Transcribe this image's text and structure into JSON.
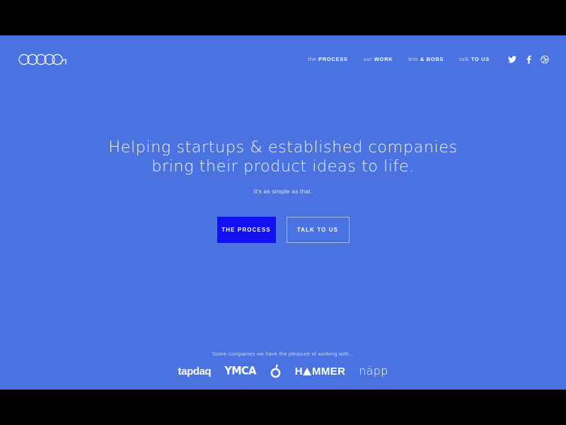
{
  "brand": {
    "logo_text": "cocoon",
    "background_color": "#4a72e0",
    "accent_color": "#1111f4",
    "letterbox_color": "#000000"
  },
  "header": {
    "nav": [
      {
        "light": "the ",
        "strong": "PROCESS",
        "name": "process"
      },
      {
        "light": "our ",
        "strong": "WORK",
        "name": "work"
      },
      {
        "light": "bits ",
        "strong": "& BOBS",
        "name": "bits-and-bobs"
      },
      {
        "light": "talk ",
        "strong": "TO US",
        "name": "talk-to-us"
      }
    ],
    "social": [
      {
        "icon": "twitter-icon"
      },
      {
        "icon": "facebook-icon"
      },
      {
        "icon": "dribbble-icon"
      }
    ]
  },
  "hero": {
    "title_line1": "Helping startups & established companies",
    "title_line2": "bring their product ideas to life.",
    "subtitle": "It's as simple as that.",
    "primary_button": "THE PROCESS",
    "secondary_button": "TALK TO US"
  },
  "clients": {
    "label": "Some companies we have the pleasure of working with...",
    "logos": [
      {
        "name": "tapdaq",
        "text": "tapdaq"
      },
      {
        "name": "ymca",
        "text": "YMCA"
      },
      {
        "name": "o-mark",
        "text": "Ó"
      },
      {
        "name": "hammer",
        "text_before": "H",
        "text_after": "MMER"
      },
      {
        "name": "napp",
        "text": "näpp"
      }
    ]
  }
}
